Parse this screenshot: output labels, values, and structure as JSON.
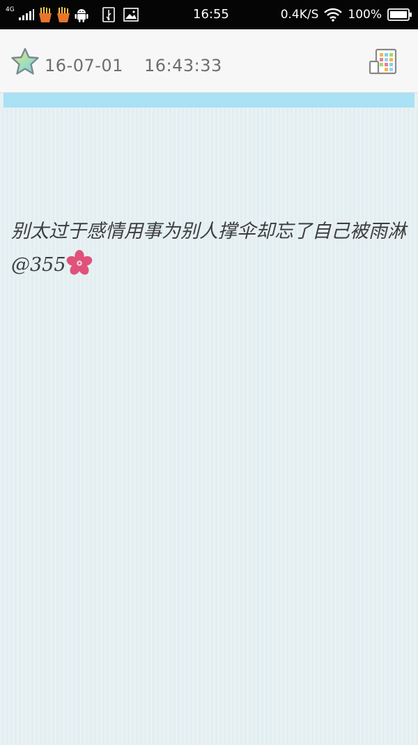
{
  "status_bar": {
    "network": "4G",
    "time": "16:55",
    "speed": "0.4K/S",
    "battery": "100%",
    "icons": [
      "signal-icon",
      "fries-icon",
      "fries-icon",
      "android-icon",
      "usb-icon",
      "image-icon",
      "wifi-icon",
      "battery-icon"
    ]
  },
  "note": {
    "date": "16-07-01",
    "time": "16:43:33",
    "text": "别太过于感情用事为别人撑伞却忘了自己被雨淋@355"
  },
  "colors": {
    "accent": "#a9e1f5",
    "paper": "#e8f1f3",
    "status_bar": "#050505",
    "flower": "#e0527a"
  }
}
